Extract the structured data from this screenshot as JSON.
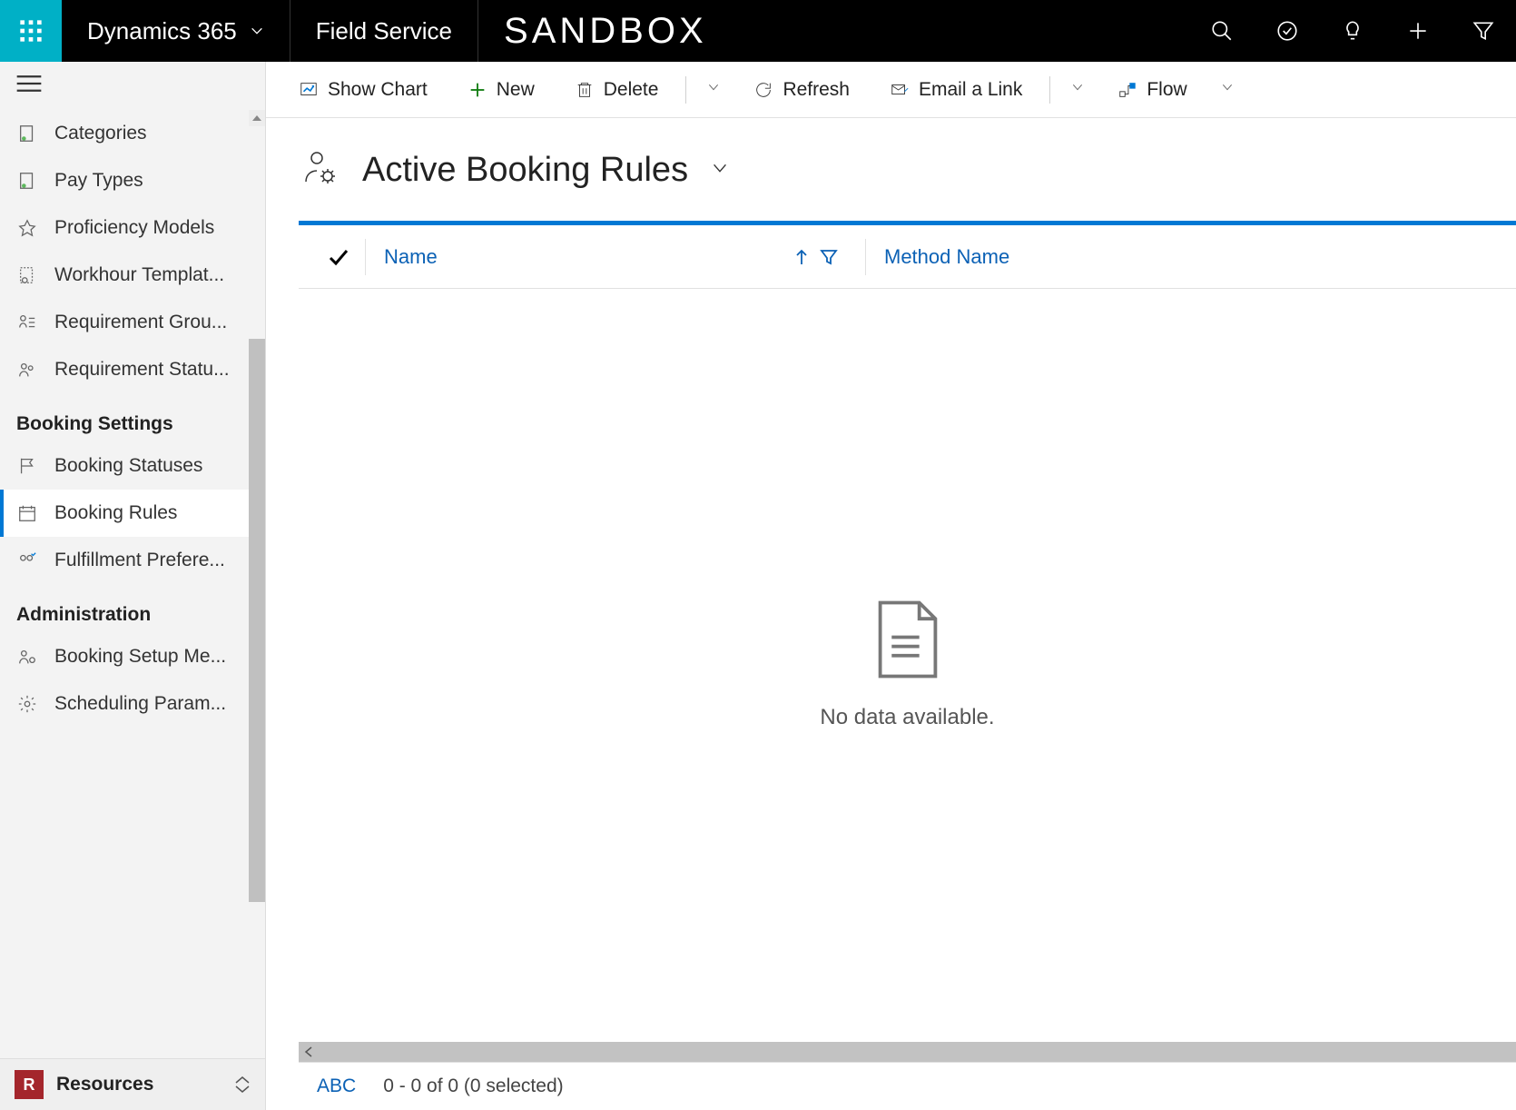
{
  "topbar": {
    "brand": "Dynamics 365",
    "module": "Field Service",
    "env": "SANDBOX"
  },
  "cmdbar": {
    "show_chart": "Show Chart",
    "new": "New",
    "delete": "Delete",
    "refresh": "Refresh",
    "email": "Email a Link",
    "flow": "Flow"
  },
  "view": {
    "title": "Active Booking Rules"
  },
  "grid": {
    "col_name": "Name",
    "col_method": "Method Name",
    "no_data": "No data available.",
    "abc": "ABC",
    "pager": "0 - 0 of 0 (0 selected)"
  },
  "sidebar": {
    "items_a": [
      {
        "label": "Categories"
      },
      {
        "label": "Pay Types"
      },
      {
        "label": "Proficiency Models"
      },
      {
        "label": "Workhour Templat..."
      },
      {
        "label": "Requirement Grou..."
      },
      {
        "label": "Requirement Statu..."
      }
    ],
    "section_booking": "Booking Settings",
    "items_b": [
      {
        "label": "Booking Statuses"
      },
      {
        "label": "Booking Rules"
      },
      {
        "label": "Fulfillment Prefere..."
      }
    ],
    "section_admin": "Administration",
    "items_c": [
      {
        "label": "Booking Setup Me..."
      },
      {
        "label": "Scheduling Param..."
      }
    ],
    "footer_badge": "R",
    "footer_label": "Resources"
  }
}
